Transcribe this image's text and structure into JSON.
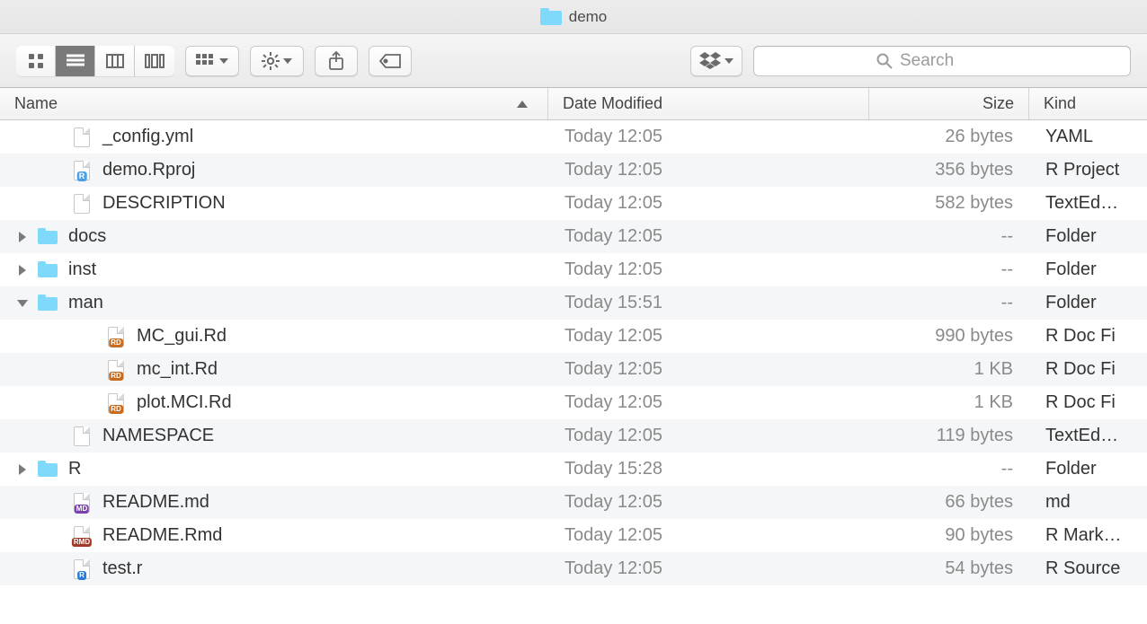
{
  "window": {
    "title": "demo"
  },
  "search": {
    "placeholder": "Search"
  },
  "columns": {
    "name": "Name",
    "date": "Date Modified",
    "size": "Size",
    "kind": "Kind"
  },
  "rows": [
    {
      "indent": 1,
      "disclosure": "",
      "icon": "doc",
      "badge": "",
      "name": "_config.yml",
      "date": "Today 12:05",
      "size": "26 bytes",
      "kind": "YAML"
    },
    {
      "indent": 1,
      "disclosure": "",
      "icon": "doc",
      "badge": "rproj",
      "name": "demo.Rproj",
      "date": "Today 12:05",
      "size": "356 bytes",
      "kind": "R Project"
    },
    {
      "indent": 1,
      "disclosure": "",
      "icon": "doc",
      "badge": "",
      "name": "DESCRIPTION",
      "date": "Today 12:05",
      "size": "582 bytes",
      "kind": "TextEd…"
    },
    {
      "indent": 0,
      "disclosure": "right",
      "icon": "folder",
      "badge": "",
      "name": "docs",
      "date": "Today 12:05",
      "size": "--",
      "kind": "Folder"
    },
    {
      "indent": 0,
      "disclosure": "right",
      "icon": "folder",
      "badge": "",
      "name": "inst",
      "date": "Today 12:05",
      "size": "--",
      "kind": "Folder"
    },
    {
      "indent": 0,
      "disclosure": "down",
      "icon": "folder",
      "badge": "",
      "name": "man",
      "date": "Today 15:51",
      "size": "--",
      "kind": "Folder"
    },
    {
      "indent": 2,
      "disclosure": "",
      "icon": "doc",
      "badge": "rd",
      "name": "MC_gui.Rd",
      "date": "Today 12:05",
      "size": "990 bytes",
      "kind": "R Doc Fi"
    },
    {
      "indent": 2,
      "disclosure": "",
      "icon": "doc",
      "badge": "rd",
      "name": "mc_int.Rd",
      "date": "Today 12:05",
      "size": "1 KB",
      "kind": "R Doc Fi"
    },
    {
      "indent": 2,
      "disclosure": "",
      "icon": "doc",
      "badge": "rd",
      "name": "plot.MCI.Rd",
      "date": "Today 12:05",
      "size": "1 KB",
      "kind": "R Doc Fi"
    },
    {
      "indent": 1,
      "disclosure": "",
      "icon": "doc",
      "badge": "",
      "name": "NAMESPACE",
      "date": "Today 12:05",
      "size": "119 bytes",
      "kind": "TextEd…"
    },
    {
      "indent": 0,
      "disclosure": "right",
      "icon": "folder",
      "badge": "",
      "name": "R",
      "date": "Today 15:28",
      "size": "--",
      "kind": "Folder"
    },
    {
      "indent": 1,
      "disclosure": "",
      "icon": "doc",
      "badge": "md",
      "name": "README.md",
      "date": "Today 12:05",
      "size": "66 bytes",
      "kind": "md"
    },
    {
      "indent": 1,
      "disclosure": "",
      "icon": "doc",
      "badge": "rmd",
      "name": "README.Rmd",
      "date": "Today 12:05",
      "size": "90 bytes",
      "kind": "R Mark…"
    },
    {
      "indent": 1,
      "disclosure": "",
      "icon": "doc",
      "badge": "r",
      "name": "test.r",
      "date": "Today 12:05",
      "size": "54 bytes",
      "kind": "R Source"
    }
  ]
}
